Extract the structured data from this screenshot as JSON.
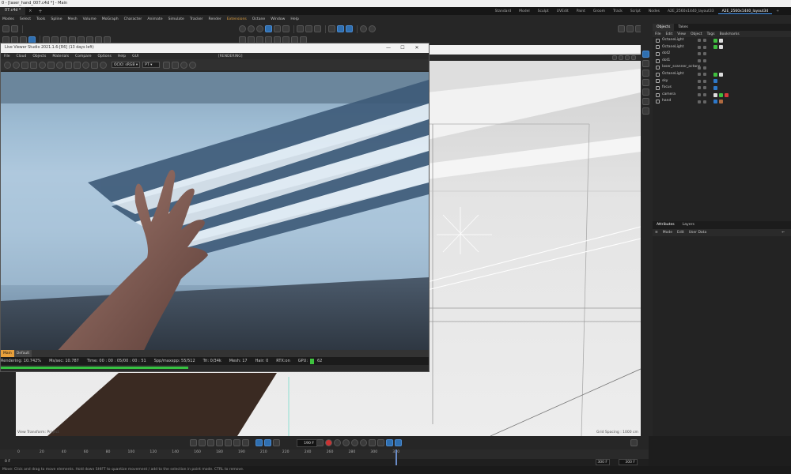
{
  "window": {
    "title": "0 - [laser_hand_007.c4d *] - Main"
  },
  "doc_tab": {
    "label": "07.c4d *",
    "add_label": "+"
  },
  "menu": [
    "Modes",
    "Select",
    "Tools",
    "Spline",
    "Mesh",
    "Volume",
    "MoGraph",
    "Character",
    "Animate",
    "Simulate",
    "Tracker",
    "Render",
    "Extensions",
    "Octane",
    "Window",
    "Help"
  ],
  "menu_highlight": "Extensions",
  "layouts": [
    "Standard",
    "Model",
    "Sculpt",
    "UVEdit",
    "Paint",
    "Groom",
    "Track",
    "Script",
    "Nodes",
    "A2E_2560x1440_layout33",
    "A2E_2560x1440_layout34"
  ],
  "active_layout": "A2E_2560x1440_layout34",
  "live_viewer": {
    "title": "Live Viewer Studio 2021.1.6-[R6] (13 days left)",
    "window_controls": [
      "—",
      "☐",
      "✕"
    ],
    "menu": [
      "File",
      "Cloud",
      "Objects",
      "Materials",
      "Compare",
      "Options",
      "Help",
      "GUI"
    ],
    "rendering_label": "[RENDERING]",
    "ocio": "OCIO: sRGB",
    "pt": "PT",
    "footer_tabs": [
      "Main",
      "Default"
    ],
    "status": {
      "rendering": "Rendering: 10.742%",
      "ms_sec": "Ms/sec: 10.787",
      "time": "Time: 00 : 00 : 05/00 : 00 : 51",
      "spp": "Spp/maxspp: 55/512",
      "tri": "Tri: 0/34k",
      "mesh": "Mesh: 17",
      "hair": "Hair: 0",
      "rtx": "RTX:on",
      "gpu": "GPU:",
      "gpu_value": "62"
    },
    "progress": 0.107
  },
  "objects_panel": {
    "tabs": [
      "Objects",
      "Takes"
    ],
    "active_tab": "Objects",
    "menu": [
      "File",
      "Edit",
      "View",
      "Object",
      "Tags",
      "Bookmarks"
    ],
    "items": [
      {
        "name": "OctaneLight",
        "tags": [
          "#3fbf3f",
          "#dddddd"
        ]
      },
      {
        "name": "OctaneLight",
        "tags": [
          "#3fbf3f",
          "#dddddd"
        ]
      },
      {
        "name": "dot2",
        "tags": []
      },
      {
        "name": "dot1",
        "tags": []
      },
      {
        "name": "laser_scanner_octane",
        "tags": []
      },
      {
        "name": "OctaneLight",
        "tags": [
          "#3fbf3f",
          "#dddddd"
        ]
      },
      {
        "name": "sky",
        "tags": [
          "#2e78c8"
        ]
      },
      {
        "name": "focus",
        "tags": [
          "#2e78c8"
        ]
      },
      {
        "name": "camera",
        "tags": [
          "#dddddd",
          "#3fbf3f",
          "#d83a3a"
        ]
      },
      {
        "name": "hand",
        "tags": [
          "#2e78c8",
          "#b06a40"
        ]
      }
    ]
  },
  "attributes_panel": {
    "tabs": [
      "Attributes",
      "Layers"
    ],
    "active_tab": "Attributes",
    "menu": [
      "Mode",
      "Edit",
      "User Data"
    ]
  },
  "viewport": {
    "transform_label": "View Transform: Project",
    "grid_label": "Grid Spacing : 1000 cm"
  },
  "timeline": {
    "current_frame": "190 F",
    "ruler_ticks": [
      "0",
      "20",
      "40",
      "60",
      "80",
      "100",
      "120",
      "140",
      "160",
      "180",
      "190",
      "210",
      "220",
      "240",
      "260",
      "280",
      "300",
      "320"
    ],
    "start_field": "0 F",
    "end_field_1": "300 F",
    "end_field_2": "300 F",
    "current_position": 0.633
  },
  "status_bar": {
    "text": "Move: Click and drag to move elements. Hold down SHIFT to quantize movement / add to the selection in point mode. CTRL to remove."
  }
}
